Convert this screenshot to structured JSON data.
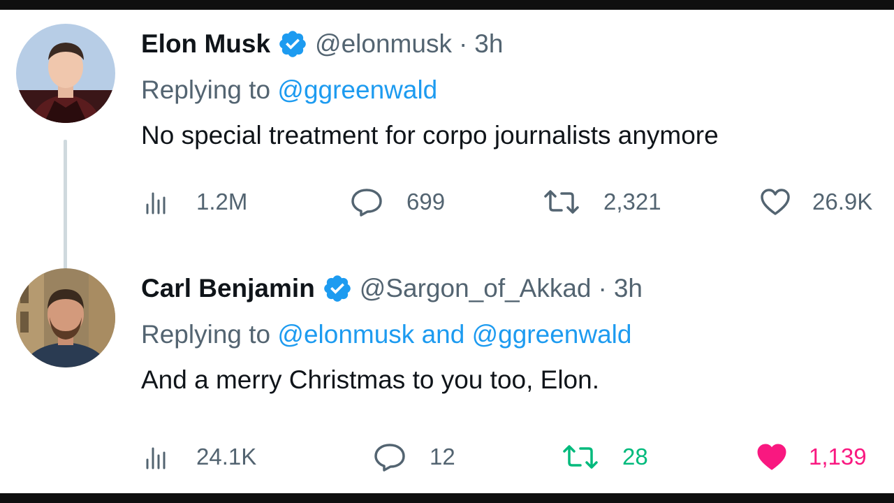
{
  "tweets": [
    {
      "name": "Elon Musk",
      "handle": "@elonmusk",
      "separator": "·",
      "time": "3h",
      "replying_prefix": "Replying to",
      "replying_to": "@ggreenwald",
      "text": "No special treatment for corpo journalists anymore",
      "stats": {
        "views": "1.2M",
        "replies": "699",
        "retweets": "2,321",
        "likes": "26.9K"
      },
      "retweeted": false,
      "liked": false
    },
    {
      "name": "Carl Benjamin",
      "handle": "@Sargon_of_Akkad",
      "separator": "·",
      "time": "3h",
      "replying_prefix": "Replying to",
      "replying_to": "@elonmusk and @ggreenwald",
      "text": "And a merry Christmas to you too, Elon.",
      "stats": {
        "views": "24.1K",
        "replies": "12",
        "retweets": "28",
        "likes": "1,139"
      },
      "retweeted": true,
      "liked": true
    }
  ],
  "colors": {
    "verified": "#1d9bf0",
    "mention": "#1d9bf0",
    "retweet_active": "#00ba7c",
    "like_active": "#f91880",
    "muted": "#536471"
  },
  "icons": [
    "views-icon",
    "reply-icon",
    "retweet-icon",
    "like-icon",
    "verified-badge-icon"
  ]
}
